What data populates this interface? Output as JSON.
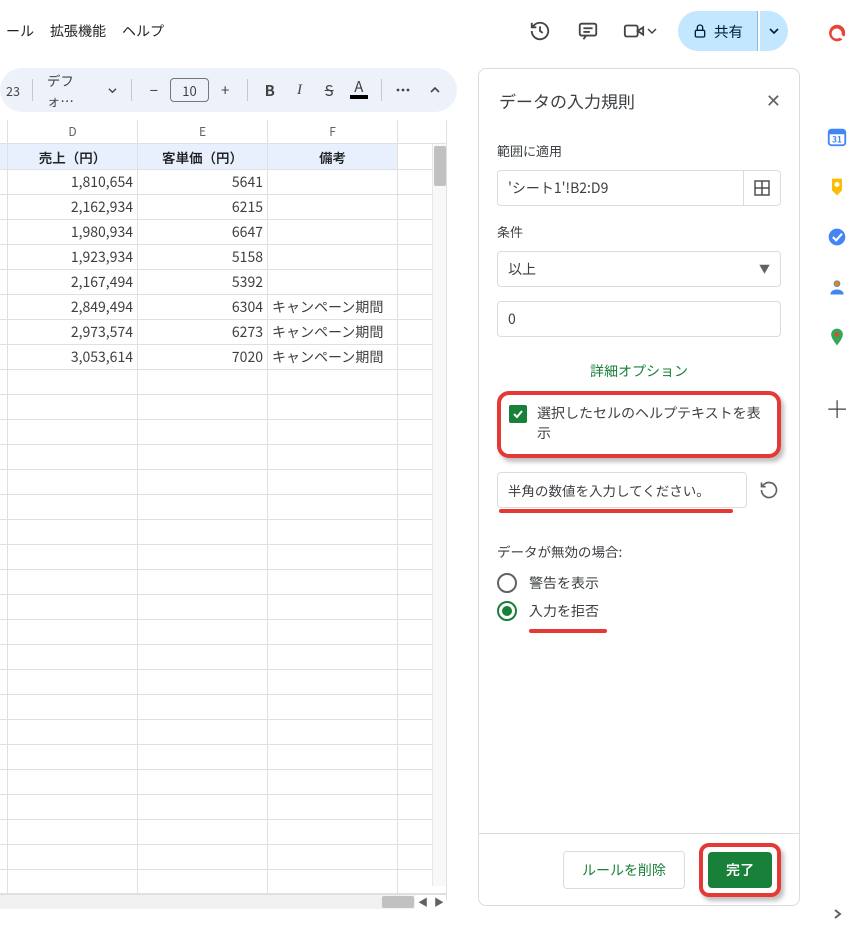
{
  "menubar": {
    "item1": "ール",
    "item2": "拡張機能",
    "item3": "ヘルプ"
  },
  "toolbar": {
    "share_label": "共有",
    "format_value": "23",
    "font_name": "デフォ…",
    "font_size": "10"
  },
  "columns": {
    "D": "D",
    "E": "E",
    "F": "F"
  },
  "headers": {
    "D": "売上（円）",
    "E": "客単価（円）",
    "F": "備考"
  },
  "rows": [
    {
      "D": "1,810,654",
      "E": "5641",
      "F": ""
    },
    {
      "D": "2,162,934",
      "E": "6215",
      "F": ""
    },
    {
      "D": "1,980,934",
      "E": "6647",
      "F": ""
    },
    {
      "D": "1,923,934",
      "E": "5158",
      "F": ""
    },
    {
      "D": "2,167,494",
      "E": "5392",
      "F": ""
    },
    {
      "D": "2,849,494",
      "E": "6304",
      "F": "キャンペーン期間"
    },
    {
      "D": "2,973,574",
      "E": "6273",
      "F": "キャンペーン期間"
    },
    {
      "D": "3,053,614",
      "E": "7020",
      "F": "キャンペーン期間"
    }
  ],
  "panel": {
    "title": "データの入力規則",
    "range_label": "範囲に適用",
    "range_value": "'シート1'!B2:D9",
    "criteria_label": "条件",
    "criteria_value": "以上",
    "criteria_number": "0",
    "advanced_link": "詳細オプション",
    "help_checkbox_label": "選択したセルのヘルプテキストを表示",
    "help_text_value": "半角の数値を入力してください。",
    "invalid_label": "データが無効の場合:",
    "option_warn": "警告を表示",
    "option_reject": "入力を拒否",
    "delete_btn": "ルールを削除",
    "done_btn": "完了"
  }
}
